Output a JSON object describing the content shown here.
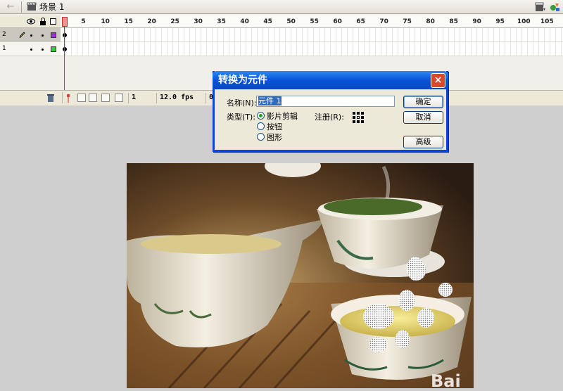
{
  "topbar": {
    "scene_label": "场景 1"
  },
  "timeline": {
    "ruler_ticks": [
      "1",
      "5",
      "10",
      "15",
      "20",
      "25",
      "30",
      "35",
      "40",
      "45",
      "50",
      "55",
      "60",
      "65",
      "70",
      "75",
      "80",
      "85",
      "90",
      "95",
      "100",
      "105"
    ],
    "layers": [
      {
        "number": "2",
        "color": "#9933cc"
      },
      {
        "number": "1",
        "color": "#33cc33"
      }
    ],
    "status": {
      "frame": "1",
      "fps": "12.0 fps",
      "time": "0"
    }
  },
  "dialog": {
    "title": "转换为元件",
    "close_label": "×",
    "name_label": "名称(N):",
    "name_value": "元件 1",
    "type_label": "类型(T):",
    "types": [
      "影片剪辑",
      "按钮",
      "图形"
    ],
    "selected_type": "影片剪辑",
    "registration_label": "注册(R):",
    "ok_label": "确定",
    "cancel_label": "取消",
    "advanced_label": "高级"
  },
  "canvas": {
    "watermark": "Bai"
  }
}
